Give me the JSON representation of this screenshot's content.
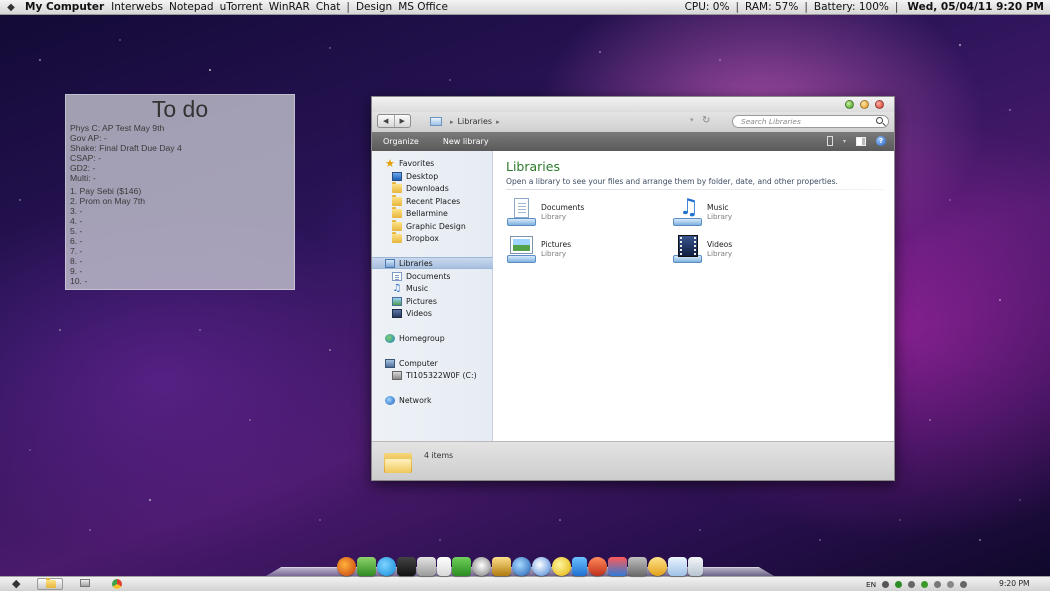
{
  "menubar": {
    "items": [
      "My Computer",
      "Interwebs",
      "Notepad",
      "uTorrent",
      "WinRAR",
      "Chat",
      "Design",
      "MS Office"
    ],
    "status": {
      "cpu": "CPU: 0%",
      "ram": "RAM: 57%",
      "battery": "Battery: 100%",
      "datetime": "Wed, 05/04/11 9:20 PM"
    }
  },
  "todo": {
    "title": "To do",
    "subjects": [
      "Phys C: AP Test May 9th",
      "Gov AP: -",
      "Shake: Final Draft Due Day 4",
      "CSAP: -",
      "GD2: -",
      "Multi: -"
    ],
    "tasks": [
      "1. Pay Sebi ($146)",
      "2. Prom on May 7th",
      "3. -",
      "4. -",
      "5. -",
      "6. -",
      "7. -",
      "8. -",
      "9. -",
      "10. -"
    ]
  },
  "explorer": {
    "breadcrumb": "Libraries",
    "search_placeholder": "Search Libraries",
    "toolbar": {
      "organize": "Organize",
      "new_library": "New library"
    },
    "nav": {
      "favorites": "Favorites",
      "favorite_items": [
        "Desktop",
        "Downloads",
        "Recent Places",
        "Bellarmine",
        "Graphic Design",
        "Dropbox"
      ],
      "libraries": "Libraries",
      "library_items": [
        "Documents",
        "Music",
        "Pictures",
        "Videos"
      ],
      "homegroup": "Homegroup",
      "computer": "Computer",
      "drive": "TI105322W0F (C:)",
      "network": "Network"
    },
    "main": {
      "title": "Libraries",
      "subtitle": "Open a library to see your files and arrange them by folder, date, and other properties.",
      "items": [
        {
          "name": "Documents",
          "type": "Library",
          "icon": "documents-library-icon"
        },
        {
          "name": "Music",
          "type": "Library",
          "icon": "music-library-icon"
        },
        {
          "name": "Pictures",
          "type": "Library",
          "icon": "pictures-library-icon"
        },
        {
          "name": "Videos",
          "type": "Library",
          "icon": "videos-library-icon"
        }
      ]
    },
    "status": "4 items"
  },
  "taskbar": {
    "lang": "EN",
    "clock": "9:20 PM"
  },
  "colors": {
    "library_title": "#2b7a2b",
    "toolbar_bg": "#6a6a6a",
    "selection": "#b6cbe6"
  }
}
